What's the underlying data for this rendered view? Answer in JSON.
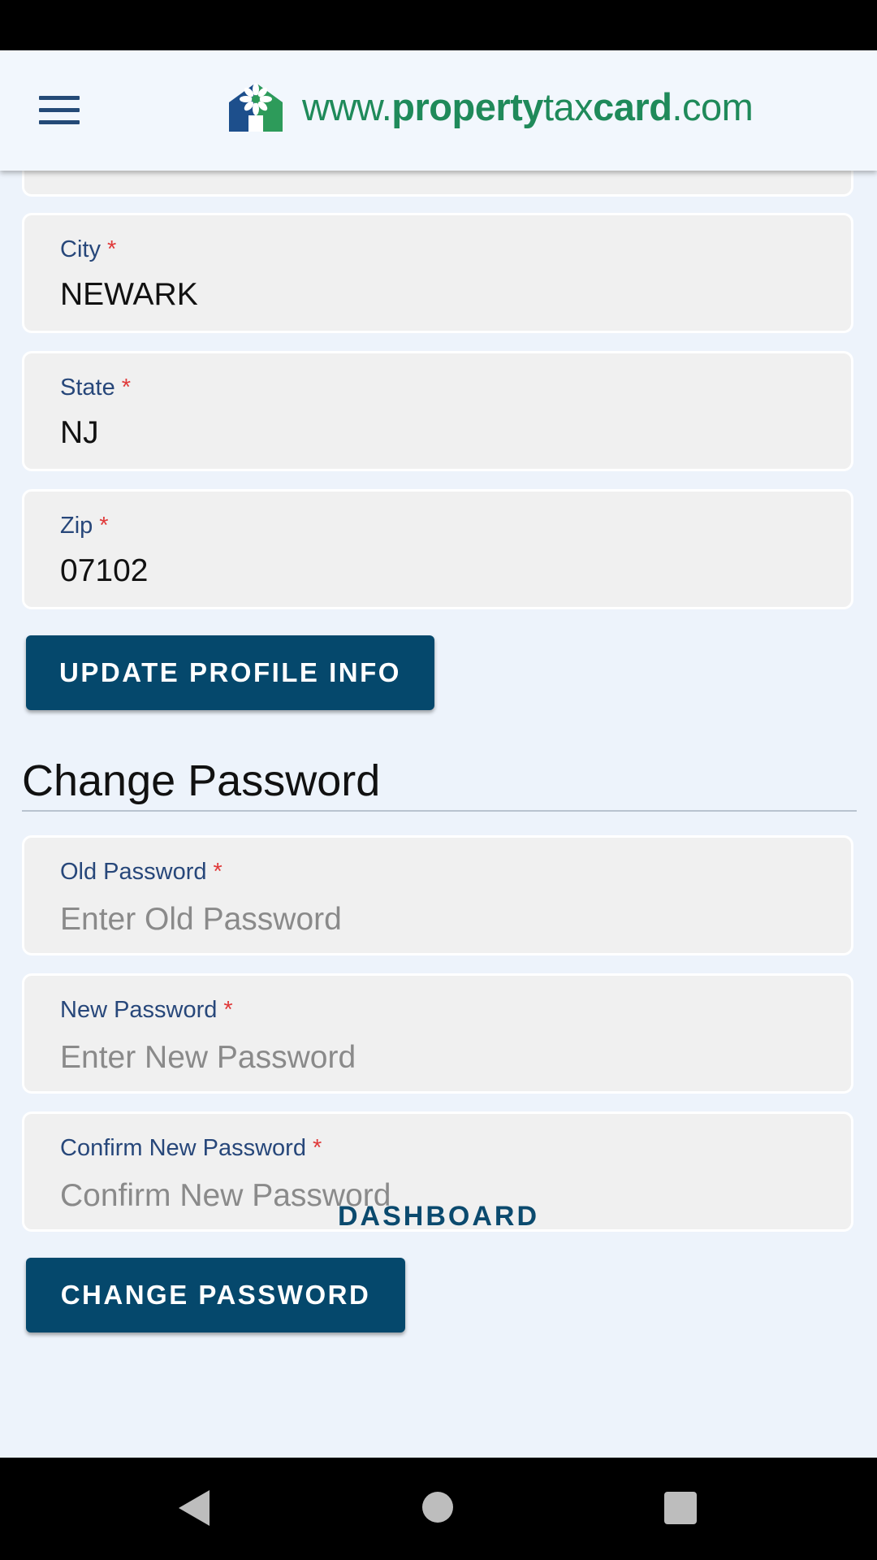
{
  "header": {
    "menu_icon": "hamburger-menu-icon",
    "logo_icon": "house-flower-logo-icon",
    "logo_www": "www.",
    "logo_property": "property",
    "logo_tax": "tax",
    "logo_card": "card",
    "logo_com": ".com"
  },
  "profile_form": {
    "city_label": "City",
    "city_value": "NEWARK",
    "state_label": "State",
    "state_value": "NJ",
    "zip_label": "Zip",
    "zip_value": "07102",
    "required_mark": "*",
    "update_button": "UPDATE PROFILE INFO"
  },
  "password_form": {
    "title": "Change Password",
    "old_label": "Old Password",
    "old_placeholder": "Enter Old Password",
    "new_label": "New Password",
    "new_placeholder": "Enter New Password",
    "confirm_label": "Confirm New Password",
    "confirm_placeholder": "Confirm New Password",
    "required_mark": "*",
    "submit_button": "CHANGE PASSWORD"
  },
  "links": {
    "dashboard": "DASHBOARD"
  },
  "system_nav": {
    "back_icon": "back-triangle-icon",
    "home_icon": "home-circle-icon",
    "recent_icon": "recent-apps-square-icon"
  },
  "colors": {
    "page_background": "#edf3fb",
    "header_background": "#f2f7fd",
    "brand_green": "#1f8a5a",
    "button_blue": "#05486c",
    "label_blue": "#27477a",
    "required_red": "#e03a3a"
  }
}
